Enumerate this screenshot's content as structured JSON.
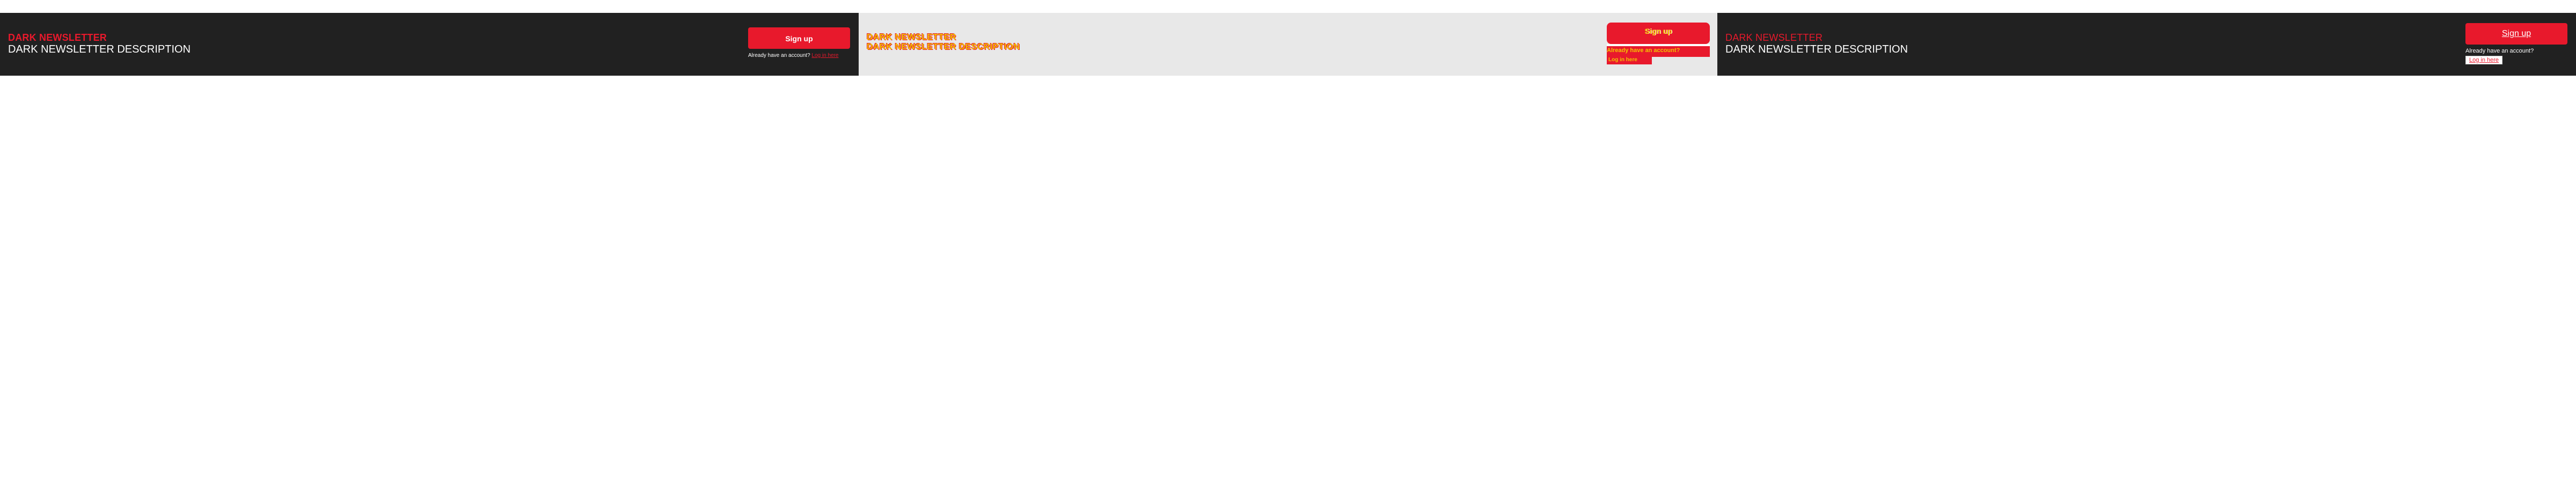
{
  "panels": [
    {
      "title": "DARK NEWSLETTER",
      "description": "DARK NEWSLETTER DESCRIPTION",
      "signup_label": "Sign up",
      "account_prompt": "Already have an account?",
      "login_label": "Log in here"
    },
    {
      "title": "DARK NEWSLETTER",
      "description": "DARK NEWSLETTER DESCRIPTION",
      "signup_label": "Sign up",
      "account_prompt": "Already have an account?",
      "login_label": "Log in here"
    },
    {
      "title": "DARK NEWSLETTER",
      "description": "DARK NEWSLETTER DESCRIPTION",
      "signup_label": "Sign up",
      "account_prompt": "Already have an account?",
      "login_label": "Log in here"
    }
  ],
  "colors": {
    "accent": "#e8192c",
    "dark_bg": "#212121",
    "light_bg": "#e8e8e8",
    "glitch_text": "#f2c200",
    "text_light": "#ffffff"
  }
}
